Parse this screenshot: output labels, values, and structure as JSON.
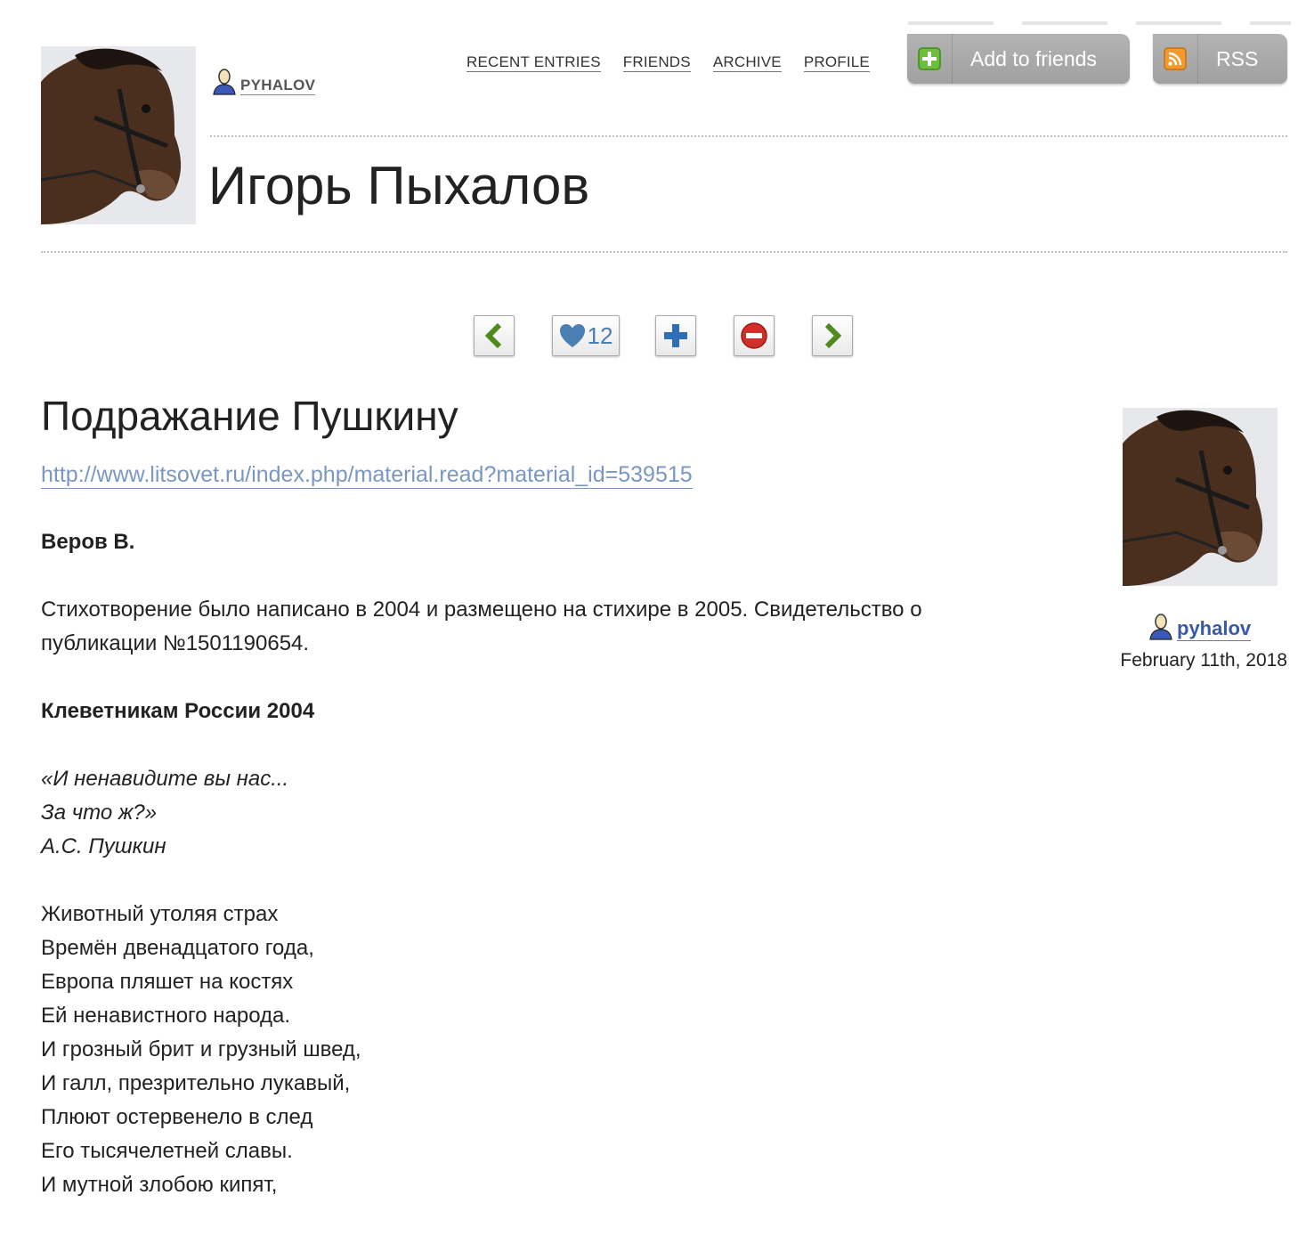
{
  "header": {
    "username": "PYHALOV",
    "journal_title": "Игорь Пыхалов",
    "nav": [
      "RECENT ENTRIES",
      "FRIENDS",
      "ARCHIVE",
      "PROFILE"
    ],
    "add_friends_label": "Add to friends",
    "rss_label": "RSS"
  },
  "controls": {
    "likes_count": "12"
  },
  "entry": {
    "title": "Подражание Пушкину",
    "link": "http://www.litsovet.ru/index.php/material.read?material_id=539515",
    "author": "Веров В.",
    "intro": "Стихотворение было написано в 2004 и размещено на стихире в 2005. Свидетельство о публикации №1501190654.",
    "poem_title": "Клеветникам России 2004",
    "epigraph": [
      "«И ненавидите вы нас...",
      "За что ж?»",
      "А.С. Пушкин"
    ],
    "poem_lines": [
      "Животный утоляя страх",
      "Времён двенадцатого года,",
      "Европа пляшет на костях",
      "Ей ненавистного народа.",
      "И грозный брит и грузный швед,",
      "И галл, презрительно лукавый,",
      "Плюют остервенело в след",
      "Его тысячелетней славы.",
      "И мутной злобою кипят,"
    ]
  },
  "sidebar": {
    "username": "pyhalov",
    "date": "February 11th, 2018"
  },
  "colors": {
    "button_gray": "#a8a8a8",
    "link_blue": "#7a97c4",
    "username_blue": "#3a5aa6",
    "nav_green": "#4e8a1e",
    "like_blue": "#4a7fb3",
    "delete_red": "#d0302a"
  }
}
